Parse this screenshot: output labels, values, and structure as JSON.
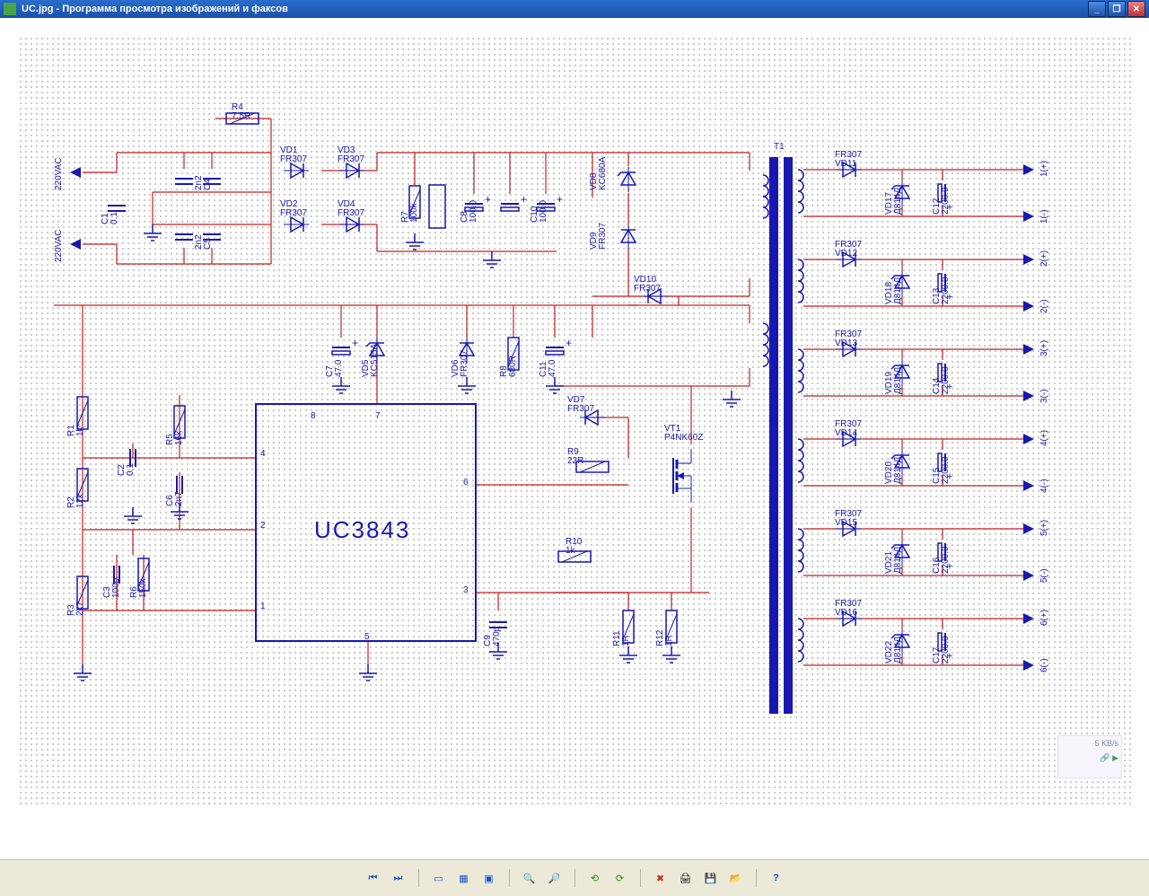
{
  "window": {
    "title": "UC.jpg - Программа просмотра изображений и факсов"
  },
  "tray": {
    "rate": "5 KB/s"
  },
  "toolbar": [
    {
      "name": "first-icon",
      "glyph": "⏮"
    },
    {
      "name": "next-icon",
      "glyph": "⏭"
    },
    {
      "name": "fit-icon",
      "glyph": "▭"
    },
    {
      "name": "actual-icon",
      "glyph": "▦"
    },
    {
      "name": "slideshow-icon",
      "glyph": "▶"
    },
    {
      "name": "zoomin-icon",
      "glyph": "🔍"
    },
    {
      "name": "zoomout-icon",
      "glyph": "🔎"
    },
    {
      "name": "rotleft-icon",
      "glyph": "⟲"
    },
    {
      "name": "rotright-icon",
      "glyph": "⟳"
    },
    {
      "name": "delete-icon",
      "glyph": "✖"
    },
    {
      "name": "print-icon",
      "glyph": "🖨"
    },
    {
      "name": "save-icon",
      "glyph": "💾"
    },
    {
      "name": "open-icon",
      "glyph": "📂"
    },
    {
      "name": "help-icon",
      "glyph": "?"
    }
  ],
  "schematic": {
    "ic_label": "UC3843",
    "transformer_ref": "T1",
    "ic_pins": {
      "p1": "1",
      "p2": "2",
      "p3": "3",
      "p4": "4",
      "p5": "5",
      "p6": "6",
      "p7": "7",
      "p8": "8"
    },
    "inputs": [
      {
        "name": "220VAC"
      },
      {
        "name": "220VAC"
      }
    ],
    "outputs": [
      {
        "pos": "1(+)",
        "neg": "1(-)"
      },
      {
        "pos": "2(+)",
        "neg": "2(-)"
      },
      {
        "pos": "3(+)",
        "neg": "3(-)"
      },
      {
        "pos": "4(+)",
        "neg": "4(-)"
      },
      {
        "pos": "5(+)",
        "neg": "5(-)"
      },
      {
        "pos": "6(+)",
        "neg": "6(-)"
      }
    ],
    "components": {
      "R1": {
        "ref": "R1",
        "value": "1k*"
      },
      "R2": {
        "ref": "R2",
        "value": "12k"
      },
      "R3": {
        "ref": "R3",
        "value": "2k7"
      },
      "R4": {
        "ref": "R4",
        "value": "7.5R"
      },
      "R5": {
        "ref": "R5",
        "value": "16k"
      },
      "R6": {
        "ref": "R6",
        "value": "150k"
      },
      "R7": {
        "ref": "R7",
        "value": "100k"
      },
      "R8": {
        "ref": "R8",
        "value": "680R"
      },
      "R9": {
        "ref": "R9",
        "value": "22R"
      },
      "R10": {
        "ref": "R10",
        "value": "1k"
      },
      "R11": {
        "ref": "R11",
        "value": "1R"
      },
      "R12": {
        "ref": "R12",
        "value": "1R"
      },
      "C1": {
        "ref": "C1",
        "value": "0.1"
      },
      "C2": {
        "ref": "C2",
        "value": "0.1"
      },
      "C3": {
        "ref": "C3",
        "value": "100p"
      },
      "C4": {
        "ref": "C4",
        "value": "2n2"
      },
      "C5": {
        "ref": "C5",
        "value": "2n2"
      },
      "C6": {
        "ref": "C6",
        "value": "2n7"
      },
      "C7": {
        "ref": "C7",
        "value": "47.0"
      },
      "C8": {
        "ref": "C8",
        "value": "100.0"
      },
      "C9": {
        "ref": "C9",
        "value": "470p"
      },
      "C10": {
        "ref": "C10",
        "value": "100.0"
      },
      "C11": {
        "ref": "C11",
        "value": "47.0"
      },
      "C12": {
        "ref": "C12",
        "value": "2200.0"
      },
      "C13": {
        "ref": "C13",
        "value": "2200.0"
      },
      "C14": {
        "ref": "C14",
        "value": "2200.0"
      },
      "C15": {
        "ref": "C15",
        "value": "2200.0"
      },
      "C16": {
        "ref": "C16",
        "value": "2200.0"
      },
      "C17": {
        "ref": "C17",
        "value": "2200.0"
      },
      "VD1": {
        "ref": "VD1",
        "value": "FR307"
      },
      "VD2": {
        "ref": "VD2",
        "value": "FR307"
      },
      "VD3": {
        "ref": "VD3",
        "value": "FR307"
      },
      "VD4": {
        "ref": "VD4",
        "value": "FR307"
      },
      "VD5": {
        "ref": "VD5",
        "value": "KC515A"
      },
      "VD6": {
        "ref": "VD6",
        "value": "FR307"
      },
      "VD7": {
        "ref": "VD7",
        "value": "FR307"
      },
      "VD8": {
        "ref": "VD8",
        "value": "KC680A"
      },
      "VD9": {
        "ref": "VD9",
        "value": "FR307"
      },
      "VD10": {
        "ref": "VD10",
        "value": "FR307"
      },
      "VD11": {
        "ref": "VD11",
        "value": "FR307"
      },
      "VD12": {
        "ref": "VD12",
        "value": "FR307"
      },
      "VD13": {
        "ref": "VD13",
        "value": "FR307"
      },
      "VD14": {
        "ref": "VD14",
        "value": "FR307"
      },
      "VD15": {
        "ref": "VD15",
        "value": "FR307"
      },
      "VD16": {
        "ref": "VD16",
        "value": "FR307"
      },
      "VD17": {
        "ref": "VD17",
        "value": "Д814Д"
      },
      "VD18": {
        "ref": "VD18",
        "value": "Д814Д"
      },
      "VD19": {
        "ref": "VD19",
        "value": "Д814Д"
      },
      "VD20": {
        "ref": "VD20",
        "value": "Д814Д"
      },
      "VD21": {
        "ref": "VD21",
        "value": "Д814Д"
      },
      "VD22": {
        "ref": "VD22",
        "value": "Д814Д"
      },
      "VT1": {
        "ref": "VT1",
        "value": "P4NK60Z"
      }
    }
  }
}
